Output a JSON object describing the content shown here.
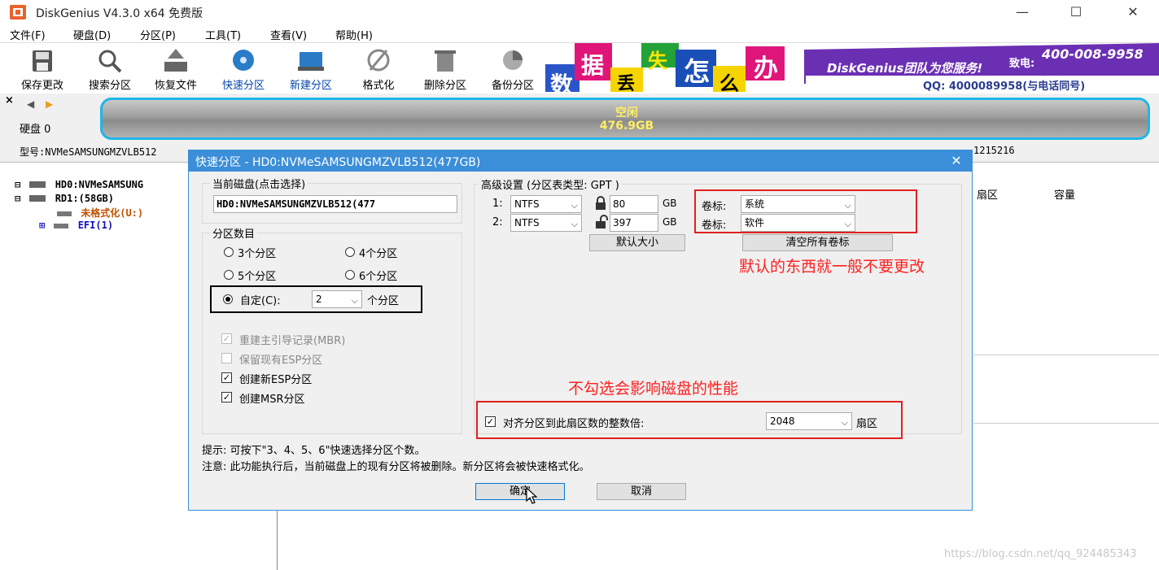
{
  "app": {
    "title": "DiskGenius V4.3.0 x64 免费版",
    "window_minimize": "—",
    "window_maximize": "☐",
    "window_close": "✕"
  },
  "menu": [
    "文件(F)",
    "硬盘(D)",
    "分区(P)",
    "工具(T)",
    "查看(V)",
    "帮助(H)"
  ],
  "toolbar": [
    "保存更改",
    "搜索分区",
    "恢复文件",
    "快速分区",
    "新建分区",
    "格式化",
    "删除分区",
    "备份分区"
  ],
  "banner": {
    "chars": [
      "数",
      "据",
      "丢",
      "失",
      "怎",
      "么",
      "办"
    ],
    "brand": "DiskGenius团队为您服务!",
    "phone_label": "致电:",
    "phone": "400-008-9958",
    "qq": "QQ: 4000089958(与电话同号)"
  },
  "diskbar": {
    "close_x": "×",
    "nav_prev": "◀",
    "nav_next": "▶",
    "disk_label": "硬盘 0",
    "free_label": "空闲",
    "free_size": "476.9GB",
    "model_line": "型号:NVMeSAMSUNGMZVLB512",
    "model_tail": "1215216"
  },
  "tree": [
    {
      "label": "HD0:NVMeSAMSUNG",
      "expander": "⊟"
    },
    {
      "label": "RD1:(58GB)",
      "expander": "⊟"
    },
    {
      "label": "未格式化(U:)",
      "expander": ""
    },
    {
      "label": "EFI(1)",
      "expander": "⊞"
    }
  ],
  "right_panel": {
    "col_sector": "扇区",
    "col_capacity": "容量"
  },
  "dialog": {
    "title": "快速分区 - HD0:NVMeSAMSUNGMZVLB512(477GB)",
    "close": "✕",
    "current_disk_label": "当前磁盘(点击选择)",
    "current_disk_value": "HD0:NVMeSAMSUNGMZVLB512(477",
    "partition_count_label": "分区数目",
    "radio_3": "3个分区",
    "radio_4": "4个分区",
    "radio_5": "5个分区",
    "radio_6": "6个分区",
    "radio_custom": "自定(C):",
    "custom_value": "2",
    "custom_suffix": "个分区",
    "cb_mbr": "重建主引导记录(MBR)",
    "cb_keep_esp": "保留现有ESP分区",
    "cb_new_esp": "创建新ESP分区",
    "cb_msr": "创建MSR分区",
    "advanced_label": "高级设置 (分区表类型: GPT )",
    "rows": [
      {
        "index": "1:",
        "fs": "NTFS",
        "size": "80",
        "unit": "GB",
        "vol_label": "卷标:",
        "vol_value": "系统"
      },
      {
        "index": "2:",
        "fs": "NTFS",
        "size": "397",
        "unit": "GB",
        "vol_label": "卷标:",
        "vol_value": "软件"
      }
    ],
    "default_size_btn": "默认大小",
    "clear_labels_btn": "清空所有卷标",
    "align_label": "对齐分区到此扇区数的整数倍:",
    "align_value": "2048",
    "align_unit": "扇区",
    "hint": "提示: 可按下\"3、4、5、6\"快速选择分区个数。",
    "note": "注意: 此功能执行后，当前磁盘上的现有分区将被删除。新分区将会被快速格式化。",
    "ok": "确定",
    "cancel": "取消"
  },
  "annotations": {
    "default_note": "默认的东西就一般不要更改",
    "align_note": "不勾选会影响磁盘的性能"
  },
  "watermark": "https://blog.csdn.net/qq_924485343",
  "colors": {
    "accent": "#3b8ed8",
    "annotation": "#ff2020",
    "disk_border": "#1fb6e8"
  }
}
